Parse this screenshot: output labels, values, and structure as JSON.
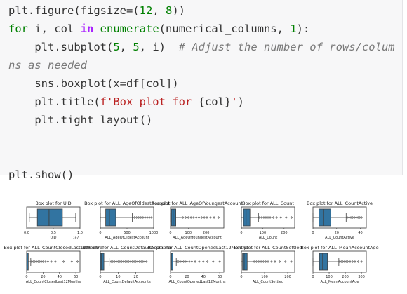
{
  "code": {
    "lines": [
      [
        {
          "t": "plt.figure(figsize=(",
          "c": ""
        },
        {
          "t": "12",
          "c": "num"
        },
        {
          "t": ", ",
          "c": ""
        },
        {
          "t": "8",
          "c": "num"
        },
        {
          "t": "))",
          "c": ""
        }
      ],
      [
        {
          "t": "for",
          "c": "kw"
        },
        {
          "t": " i, col ",
          "c": ""
        },
        {
          "t": "in",
          "c": "kw2"
        },
        {
          "t": " ",
          "c": ""
        },
        {
          "t": "enumerate",
          "c": "kw"
        },
        {
          "t": "(numerical_columns, ",
          "c": ""
        },
        {
          "t": "1",
          "c": "num"
        },
        {
          "t": "):",
          "c": ""
        }
      ],
      [
        {
          "t": "    plt.subplot(",
          "c": ""
        },
        {
          "t": "5",
          "c": "num"
        },
        {
          "t": ", ",
          "c": ""
        },
        {
          "t": "5",
          "c": "num"
        },
        {
          "t": ", i)  ",
          "c": ""
        },
        {
          "t": "# Adjust the number of rows/colum",
          "c": "cm"
        }
      ],
      [
        {
          "t": "ns as needed",
          "c": "cm"
        }
      ],
      [
        {
          "t": "    sns.boxplot(x=df[col])",
          "c": ""
        }
      ],
      [
        {
          "t": "    plt.title(",
          "c": ""
        },
        {
          "t": "f'Box plot for ",
          "c": "str"
        },
        {
          "t": "{col}",
          "c": ""
        },
        {
          "t": "'",
          "c": "str"
        },
        {
          "t": ")",
          "c": ""
        }
      ],
      [
        {
          "t": "    plt.tight_layout()",
          "c": ""
        }
      ],
      [
        {
          "t": "",
          "c": ""
        }
      ],
      [
        {
          "t": "",
          "c": ""
        }
      ],
      [
        {
          "t": "plt.show()",
          "c": ""
        }
      ]
    ]
  },
  "colors": {
    "box_fill": "#3274a1",
    "box_edge": "#3f3f3f",
    "axis": "#333333",
    "text": "#222222",
    "flier": "#3f3f3f"
  },
  "chart_data": [
    {
      "type": "box",
      "title": "Box plot for UID",
      "xlabel": "UID",
      "xlim": [
        0,
        1
      ],
      "xticks": [
        "0.0",
        "0.5",
        "1.0"
      ],
      "offset_text": "1e7",
      "stats": {
        "min": 0.05,
        "q1": 0.2,
        "median": 0.42,
        "q3": 0.67,
        "max": 0.92
      },
      "outliers": []
    },
    {
      "type": "box",
      "title": "Box plot for ALL_AgeOfOldestAccount",
      "xlabel": "ALL_AgeOfOldestAccount",
      "xlim": [
        0,
        1000
      ],
      "xticks": [
        "0",
        "500",
        "1000"
      ],
      "stats": {
        "min": 0,
        "q1": 100,
        "median": 170,
        "q3": 290,
        "max": 600
      },
      "outliers": [
        640,
        680,
        720,
        760,
        800,
        840,
        880,
        920,
        960
      ]
    },
    {
      "type": "box",
      "title": "Box plot for ALL_AgeOfYoungestAccount",
      "xlabel": "ALL_AgeOfYoungestAccount",
      "xlim": [
        0,
        300
      ],
      "xticks": [
        "0",
        "100",
        "200"
      ],
      "stats": {
        "min": 0,
        "q1": 5,
        "median": 15,
        "q3": 30,
        "max": 65
      },
      "outliers": [
        70,
        85,
        100,
        115,
        130,
        145,
        160,
        175,
        190,
        205,
        225,
        245,
        270
      ]
    },
    {
      "type": "box",
      "title": "Box plot for ALL_Count",
      "xlabel": "ALL_Count",
      "xlim": [
        0,
        250
      ],
      "xticks": [
        "0",
        "100",
        "200"
      ],
      "stats": {
        "min": 0,
        "q1": 10,
        "median": 22,
        "q3": 40,
        "max": 80
      },
      "outliers": [
        85,
        95,
        105,
        115,
        125,
        135,
        150,
        165,
        185,
        210,
        235
      ]
    },
    {
      "type": "box",
      "title": "Box plot for ALL_CountActive",
      "xlabel": "ALL_CountActive",
      "xlim": [
        0,
        45
      ],
      "xticks": [
        "0",
        "20",
        "40"
      ],
      "stats": {
        "min": 0,
        "q1": 5,
        "median": 9,
        "q3": 15,
        "max": 28
      },
      "outliers": [
        29,
        30.5,
        32,
        33.5,
        35,
        36.5,
        38,
        39.5,
        41
      ]
    },
    {
      "type": "box",
      "title": "Box plot for ALL_CountClosedLast12Months",
      "xlabel": "ALL_CountClosedLast12Months",
      "xlim": [
        0,
        65
      ],
      "xticks": [
        "0",
        "20",
        "40",
        "60"
      ],
      "stats": {
        "min": 0,
        "q1": 0,
        "median": 0.5,
        "q3": 2,
        "max": 5
      },
      "outliers": [
        6,
        8,
        10,
        12,
        14,
        16,
        18,
        20,
        23,
        26,
        30,
        35,
        45,
        55,
        62
      ]
    },
    {
      "type": "box",
      "title": "Box plot for ALL_CountDefaultAccounts",
      "xlabel": "ALL_CountDefaultAccounts",
      "xlim": [
        0,
        30
      ],
      "xticks": [
        "0",
        "10",
        "20"
      ],
      "stats": {
        "min": 0,
        "q1": 0,
        "median": 0.5,
        "q3": 2,
        "max": 5
      },
      "outliers": [
        6,
        7,
        8,
        9,
        10,
        11,
        12,
        13,
        14,
        15,
        16,
        17,
        18,
        19,
        20,
        21,
        22,
        23,
        24,
        25,
        26
      ]
    },
    {
      "type": "box",
      "title": "Box plot for ALL_CountOpenedLast12Months",
      "xlabel": "ALL_CountOpenedLast12Months",
      "xlim": [
        0,
        65
      ],
      "xticks": [
        "0",
        "20",
        "40",
        "60"
      ],
      "stats": {
        "min": 0,
        "q1": 0,
        "median": 1,
        "q3": 3,
        "max": 7
      },
      "outliers": [
        8,
        10,
        12,
        14,
        16,
        18,
        20,
        23,
        26,
        30,
        35,
        40,
        45,
        52,
        60
      ]
    },
    {
      "type": "box",
      "title": "Box plot for ALL_CountSettled",
      "xlabel": "ALL_CountSettled",
      "xlim": [
        0,
        230
      ],
      "xticks": [
        "0",
        "100",
        "200"
      ],
      "stats": {
        "min": 0,
        "q1": 5,
        "median": 12,
        "q3": 25,
        "max": 50
      },
      "outliers": [
        55,
        65,
        75,
        85,
        95,
        105,
        115,
        130,
        145,
        165,
        190,
        215
      ]
    },
    {
      "type": "box",
      "title": "Box plot for ALL_MeanAccountAge",
      "xlabel": "ALL_MeanAccountAge",
      "xlim": [
        0,
        330
      ],
      "xticks": [
        "0",
        "100",
        "200",
        "300"
      ],
      "stats": {
        "min": 0,
        "q1": 40,
        "median": 60,
        "q3": 90,
        "max": 160
      },
      "outliers": [
        165,
        175,
        185,
        195,
        205,
        215,
        230,
        245,
        260,
        280,
        300
      ]
    }
  ]
}
